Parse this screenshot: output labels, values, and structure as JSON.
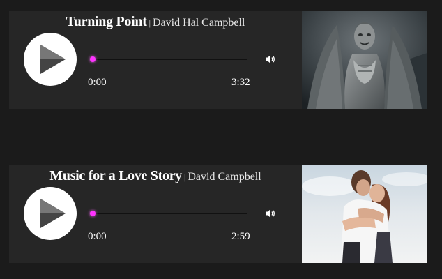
{
  "players": [
    {
      "track_title": "Turning Point",
      "separator": "|",
      "artist": "David Hal Campbell",
      "current_time": "0:00",
      "duration": "3:32",
      "progress": 0,
      "artwork_icon": "angel-statue-artwork"
    },
    {
      "track_title": "Music for a Love Story",
      "separator": "|",
      "artist": "David Campbell",
      "current_time": "0:00",
      "duration": "2:59",
      "progress": 0,
      "artwork_icon": "embracing-couple-artwork"
    }
  ],
  "colors": {
    "page_background": "#1b1b1b",
    "player_background": "#262626",
    "seek_knob": "#ff33ff"
  }
}
